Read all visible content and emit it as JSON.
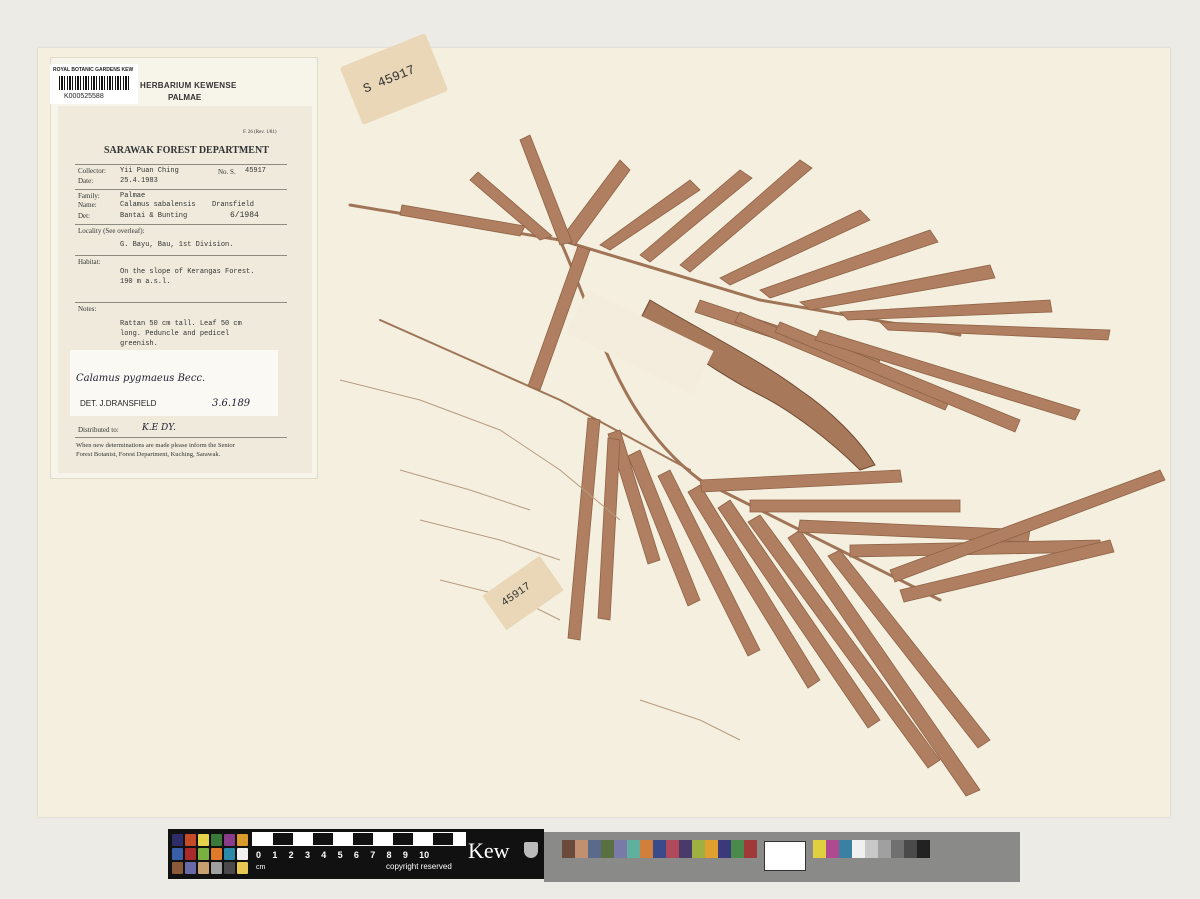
{
  "ruler": {
    "numbers": [
      "0",
      "1",
      "2",
      "3",
      "4",
      "5",
      "6",
      "7",
      "8",
      "9",
      "10"
    ],
    "unit": "cm",
    "brand": "Kew",
    "copyright": "copyright reserved",
    "swatch_colors": [
      "#2d2d6a",
      "#c64a27",
      "#e5d14a",
      "#3a7a3a",
      "#8a3c8a",
      "#d99a2a",
      "#3a5fa8",
      "#a82a2a",
      "#7ab040",
      "#e07a2a",
      "#2a8aa8",
      "#f0f0f0",
      "#8a5a3a",
      "#6a6aa8",
      "#c8a070",
      "#a0a0a0",
      "#4a4a4a",
      "#e8c850"
    ],
    "strip_colors": [
      "#6a4a3a",
      "#c09070",
      "#5a6a8a",
      "#5a7040",
      "#7a7aa8",
      "#60b0a0",
      "#d0803a",
      "#3a4a8a",
      "#b04a5a",
      "#4a3a6a",
      "#a0b040",
      "#e0a030",
      "#3a3a7a",
      "#4a8a4a",
      "#a03a3a",
      "#e0d040",
      "#b04a90",
      "#3a80a0",
      "#f0f0f0",
      "#c8c8c8",
      "#a0a0a0",
      "#707070",
      "#4a4a4a",
      "#222"
    ]
  },
  "barcode": {
    "title": "ROYAL BOTANIC GARDENS KEW",
    "id": "K000525588"
  },
  "herbarium": {
    "title": "HERBARIUM KEWENSE",
    "subtitle": "PALMAE"
  },
  "label": {
    "form_no": "F. 26 (Rev. 1/81)",
    "department": "SARAWAK FOREST DEPARTMENT",
    "collector_label": "Collector:",
    "collector": "Yii Puan Ching",
    "date_label": "Date:",
    "date": "25.4.1983",
    "number_label": "No. S.",
    "number": "45917",
    "family_label": "Family:",
    "family": "Palmae",
    "name_label": "Name:",
    "name": "Calamus sabalensis",
    "name_author": "Dransfield",
    "det_label": "Det:",
    "det": "Bantai & Bunting",
    "det_date": "6/1984",
    "locality_label": "Locality (See overleaf):",
    "locality": "G. Bayu, Bau, 1st Division.",
    "habitat_label": "Habitat:",
    "habitat_1": "On the slope of Kerangas Forest.",
    "habitat_2": "190 m a.s.l.",
    "notes_label": "Notes:",
    "notes_1": "Rattan 50 cm tall.  Leaf 50 cm",
    "notes_2": "long.  Peduncle and pedicel",
    "notes_3": "greenish.",
    "det_slip_name": "Calamus pygmaeus Becc.",
    "det_slip_by": "DET.  J.DRANSFIELD",
    "det_slip_date": "3.6.189",
    "distributed_label": "Distributed to:",
    "distributed": "K.E  DY.",
    "footer_1": "When new determinations are made please inform the Senior",
    "footer_2": "Forest Botanist, Forest Department, Kuching, Sarawak."
  },
  "tags": {
    "top_tag_number": "S 45917",
    "bottom_tag_number": "45917"
  }
}
